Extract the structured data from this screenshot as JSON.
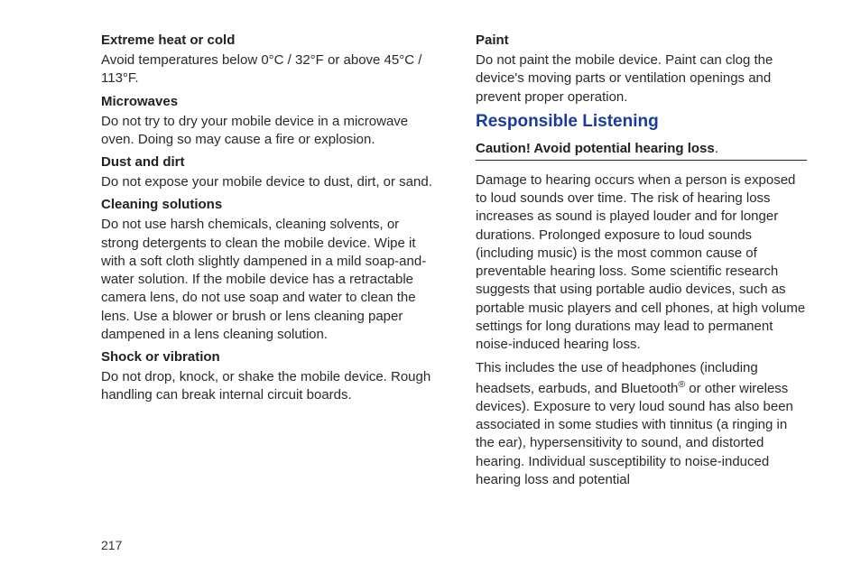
{
  "page_number": "217",
  "left": {
    "s1_title": "Extreme heat or cold",
    "s1_body": "Avoid temperatures below 0°C / 32°F or above 45°C / 113°F.",
    "s2_title": "Microwaves",
    "s2_body": "Do not try to dry your mobile device in a microwave oven. Doing so may cause a fire or explosion.",
    "s3_title": "Dust and dirt",
    "s3_body": "Do not expose your mobile device to dust, dirt, or sand.",
    "s4_title": "Cleaning solutions",
    "s4_body": "Do not use harsh chemicals, cleaning solvents, or strong detergents to clean the mobile device. Wipe it with a soft cloth slightly dampened in a mild soap-and-water solution. If the mobile device has a retractable camera lens, do not use soap and water to clean the lens. Use a blower or brush or lens cleaning paper dampened in a lens cleaning solution.",
    "s5_title": "Shock or vibration",
    "s5_body": "Do not drop, knock, or shake the mobile device. Rough handling can break internal circuit boards."
  },
  "right": {
    "s1_title": "Paint",
    "s1_body": "Do not paint the mobile device. Paint can clog the device's moving parts or ventilation openings and prevent proper operation.",
    "section_title": "Responsible Listening",
    "caution_bold": "Caution! Avoid potential hearing loss",
    "caution_tail": ".",
    "p1": "Damage to hearing occurs when a person is exposed to loud sounds over time. The risk of hearing loss increases as sound is played louder and for longer durations. Prolonged exposure to loud sounds (including music) is the most common cause of preventable hearing loss. Some scientific research suggests that using portable audio devices, such as portable music players and cell phones, at high volume settings for long durations may lead to permanent noise-induced hearing loss.",
    "p2a": "This includes the use of headphones (including headsets, earbuds, and Bluetooth",
    "p2sup": "®",
    "p2b": " or other wireless devices). Exposure to very loud sound has also been associated in some studies with tinnitus (a ringing in the ear), hypersensitivity to sound, and distorted hearing. Individual susceptibility to noise-induced hearing loss and potential"
  }
}
